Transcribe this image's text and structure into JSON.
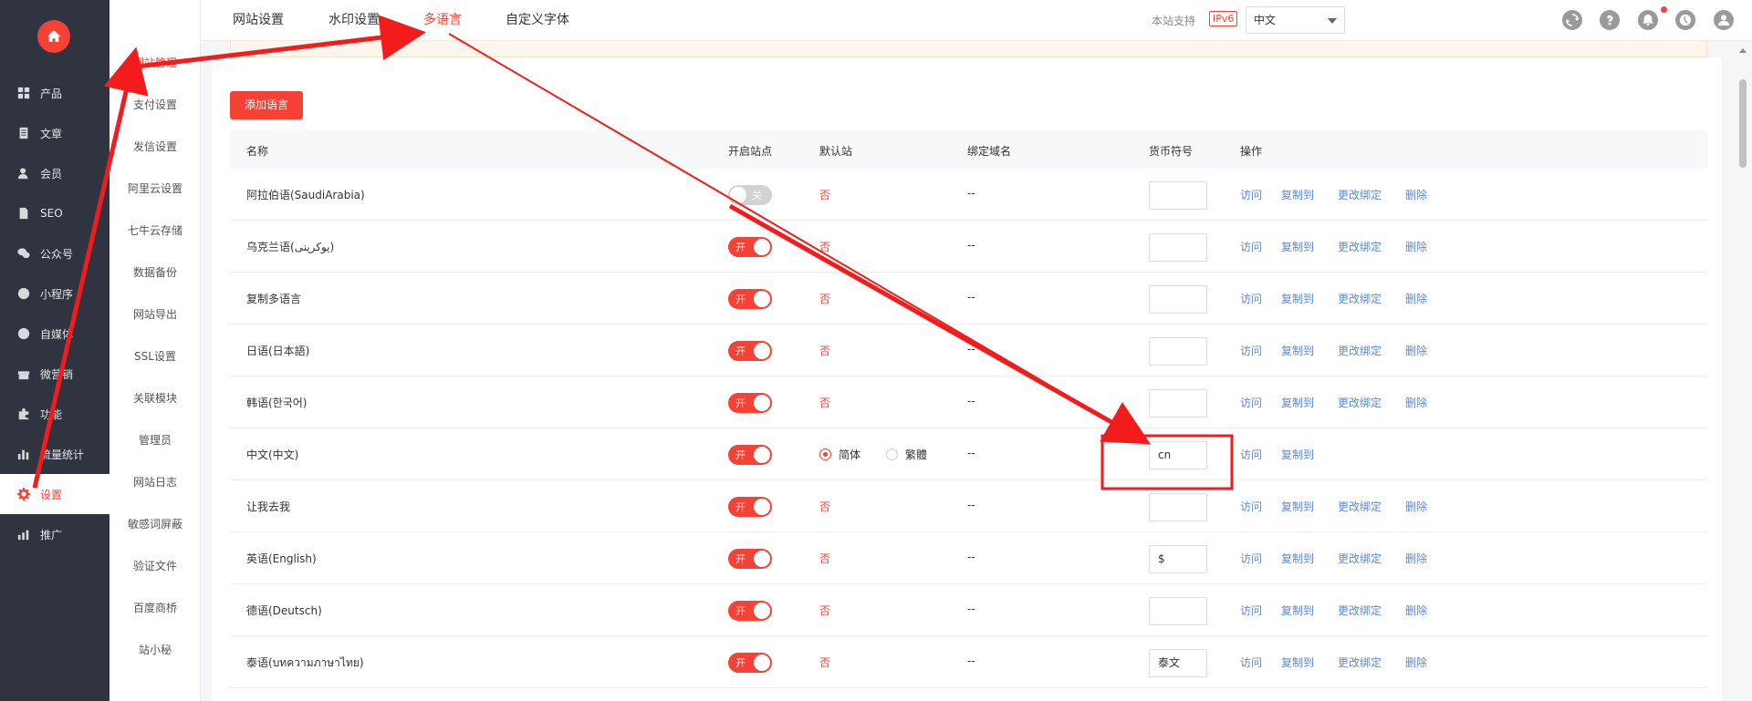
{
  "sidebar": {
    "items": [
      {
        "label": "产品",
        "icon": "grid-icon"
      },
      {
        "label": "文章",
        "icon": "document-icon"
      },
      {
        "label": "会员",
        "icon": "user-icon"
      },
      {
        "label": "SEO",
        "icon": "file-icon"
      },
      {
        "label": "公众号",
        "icon": "wechat-icon"
      },
      {
        "label": "小程序",
        "icon": "miniprogram-icon"
      },
      {
        "label": "自媒体",
        "icon": "media-icon"
      },
      {
        "label": "微营销",
        "icon": "gift-icon"
      },
      {
        "label": "功能",
        "icon": "puzzle-icon"
      },
      {
        "label": "流量统计",
        "icon": "bar-chart-icon"
      },
      {
        "label": "设置",
        "icon": "gear-icon"
      },
      {
        "label": "推广",
        "icon": "chart-icon"
      }
    ]
  },
  "subnav": {
    "items": [
      "网站管理",
      "支付设置",
      "发信设置",
      "阿里云设置",
      "七牛云存储",
      "数据备份",
      "网站导出",
      "SSL设置",
      "关联模块",
      "管理员",
      "网站日志",
      "敏感词屏蔽",
      "验证文件",
      "百度商桥",
      "站小秘"
    ]
  },
  "topbar": {
    "tabs": [
      "网站设置",
      "水印设置",
      "多语言",
      "自定义字体"
    ],
    "support_text": "本站支持",
    "ipv6": "IPv6",
    "language": "中文"
  },
  "toolbar": {
    "add_language": "添加语言"
  },
  "table": {
    "headers": [
      "名称",
      "开启站点",
      "默认站",
      "绑定域名",
      "货币符号",
      "操作"
    ],
    "switch_on": "开",
    "switch_off": "关",
    "default_no": "否",
    "domain_empty": "--",
    "radio_simplified": "简体",
    "radio_traditional": "繁體",
    "op_visit": "访问",
    "op_copy": "复制到",
    "op_rebind": "更改绑定",
    "op_delete": "删除",
    "rows": [
      {
        "name": "阿拉伯语(SaudiArabia)",
        "enabled": false,
        "currency": ""
      },
      {
        "name": "乌克兰语(یوکرینی)",
        "enabled": true,
        "currency": ""
      },
      {
        "name": "复制多语言",
        "enabled": true,
        "currency": ""
      },
      {
        "name": "日语(日本語)",
        "enabled": true,
        "currency": ""
      },
      {
        "name": "韩语(한국어)",
        "enabled": true,
        "currency": ""
      },
      {
        "name": "中文(中文)",
        "enabled": true,
        "currency": "cn"
      },
      {
        "name": "让我去我",
        "enabled": true,
        "currency": ""
      },
      {
        "name": "英语(English)",
        "enabled": true,
        "currency": "$"
      },
      {
        "name": "德语(Deutsch)",
        "enabled": true,
        "currency": ""
      },
      {
        "name": "泰语(บทความภาษาไทย)",
        "enabled": true,
        "currency": "泰文"
      }
    ]
  },
  "colors": {
    "accent": "#f44336",
    "sidebar": "#2f3440",
    "link": "#5b8ad6"
  }
}
